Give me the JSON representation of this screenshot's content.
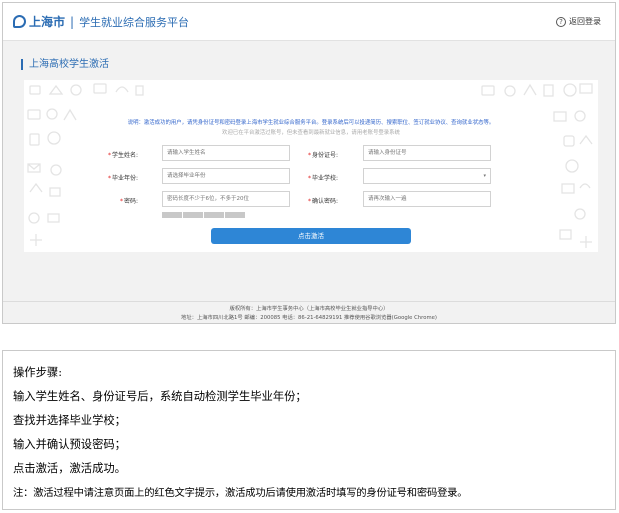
{
  "header": {
    "logo_text": "上海市",
    "separator": "|",
    "site_title": "学生就业综合服务平台",
    "back_label": "返回登录",
    "help_glyph": "?"
  },
  "section_title": "上海高校学生激活",
  "notes": {
    "line1": "说明：激活成功的用户，请凭身份证号和密码登录上海市学生就业综合服务平台。登录系统后可以投递简历、搜索职位、签订就业协议、查询就业状态等。",
    "line2": "欢迎已在平台激活过账号，但未查看到最新就业信息，请用老账号登录系统"
  },
  "form": {
    "star": "*",
    "name_label": "学生姓名:",
    "name_placeholder": "请输入学生姓名",
    "id_label": "身份证号:",
    "id_placeholder": "请输入身份证号",
    "year_label": "毕业年份:",
    "year_placeholder": "请选择毕业年份",
    "school_label": "毕业学校:",
    "school_arrow": "▾",
    "pw_label": "密码:",
    "pw_placeholder": "密码长度不少于6位，不多于20位",
    "confirm_label": "确认密码:",
    "confirm_placeholder": "请再次输入一遍",
    "submit_label": "点击激活"
  },
  "footer": {
    "line1": "版权所有：上海市学生事务中心（上海市高校毕业生就业指导中心）",
    "line2": "地址：上海市四川北路1号   邮编：200085   电话：86-21-64829191   推荐使用谷歌浏览器(Google Chrome)"
  },
  "instructions": {
    "heading": "操作步骤:",
    "step1": "输入学生姓名、身份证号后，系统自动检测学生毕业年份；",
    "step2": "查找并选择毕业学校；",
    "step3": "输入并确认预设密码；",
    "step4": "点击激活，激活成功。",
    "note": "注：激活过程中请注意页面上的红色文字提示，激活成功后请使用激活时填写的身份证号和密码登录。"
  },
  "colors": {
    "brand_blue": "#2b6cb3",
    "button_blue": "#2e86d6",
    "required_red": "#e02020",
    "note_blue": "#3366cc"
  }
}
